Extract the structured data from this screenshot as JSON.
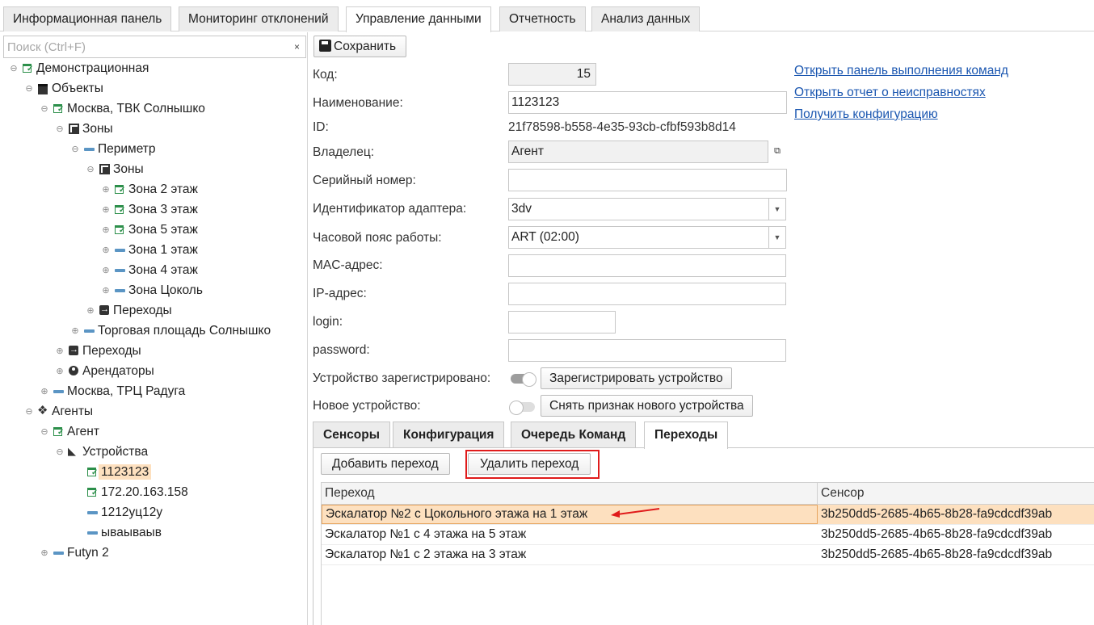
{
  "top_tabs": [
    "Информационная панель",
    "Мониторинг отклонений",
    "Управление данными",
    "Отчетность",
    "Анализ данных"
  ],
  "active_top_tab": "Управление данными",
  "search": {
    "placeholder": "Поиск (Ctrl+F)",
    "clear": "×"
  },
  "tree": [
    {
      "label": "Демонстрационная",
      "icon": "object-check-icon",
      "expander": "⊖"
    },
    {
      "label": "Объекты",
      "icon": "building-icon",
      "expander": "⊖"
    },
    {
      "label": "Москва, ТВК Солнышко",
      "icon": "object-check-icon",
      "expander": "⊖"
    },
    {
      "label": "Зоны",
      "icon": "zones-icon",
      "expander": "⊖"
    },
    {
      "label": "Периметр",
      "icon": "zone-dash-icon",
      "expander": "⊖"
    },
    {
      "label": "Зоны",
      "icon": "zones-icon",
      "expander": "⊖"
    },
    {
      "label": "Зона 2 этаж",
      "icon": "object-check-icon",
      "expander": "⊕"
    },
    {
      "label": "Зона 3 этаж",
      "icon": "object-check-icon",
      "expander": "⊕"
    },
    {
      "label": "Зона 5 этаж",
      "icon": "object-check-icon",
      "expander": "⊕"
    },
    {
      "label": "Зона 1 этаж",
      "icon": "zone-dash-icon",
      "expander": "⊕"
    },
    {
      "label": "Зона 4 этаж",
      "icon": "zone-dash-icon",
      "expander": "⊕"
    },
    {
      "label": "Зона Цоколь",
      "icon": "zone-dash-icon",
      "expander": "⊕"
    },
    {
      "label": "Переходы",
      "icon": "transition-icon",
      "expander": "⊕"
    },
    {
      "label": "Торговая площадь Солнышко",
      "icon": "zone-dash-icon",
      "expander": "⊕"
    },
    {
      "label": "Переходы",
      "icon": "transition-icon",
      "expander": "⊕"
    },
    {
      "label": "Арендаторы",
      "icon": "tenant-icon",
      "expander": "⊕"
    },
    {
      "label": "Москва, ТРЦ Радуга",
      "icon": "zone-dash-icon",
      "expander": "⊕"
    },
    {
      "label": "Агенты",
      "icon": "agents-icon",
      "expander": "⊖"
    },
    {
      "label": "Агент",
      "icon": "object-check-icon",
      "expander": "⊖"
    },
    {
      "label": "Устройства",
      "icon": "camera-icon",
      "expander": "⊖"
    },
    {
      "label": "1123123",
      "icon": "object-check-icon",
      "expander": ""
    },
    {
      "label": "172.20.163.158",
      "icon": "object-check-icon",
      "expander": ""
    },
    {
      "label": "1212уц12у",
      "icon": "zone-dash-icon",
      "expander": ""
    },
    {
      "label": "ываываыв",
      "icon": "zone-dash-icon",
      "expander": ""
    },
    {
      "label": "Futyn 2",
      "icon": "zone-dash-icon",
      "expander": "⊕"
    }
  ],
  "selected_tree_item": "1123123",
  "toolbar": {
    "save_label": "Сохранить"
  },
  "form": {
    "code_label": "Код:",
    "code_value": "15",
    "name_label": "Наименование:",
    "name_value": "1123123",
    "id_label": "ID:",
    "id_value": "21f78598-b558-4e35-93cb-cfbf593b8d14",
    "owner_label": "Владелец:",
    "owner_value": "Агент",
    "serial_label": "Серийный номер:",
    "serial_value": "",
    "adapter_label": "Идентификатор адаптера:",
    "adapter_value": "3dv",
    "timezone_label": "Часовой пояс работы:",
    "timezone_value": "ART (02:00)",
    "mac_label": "MAC-адрес:",
    "mac_value": "",
    "ip_label": "IP-адрес:",
    "ip_value": "",
    "login_label": "login:",
    "login_value": "",
    "password_label": "password:",
    "password_value": "",
    "registered_label": "Устройство зарегистрировано:",
    "registered": true,
    "register_button": "Зарегистрировать устройство",
    "new_device_label": "Новое устройство:",
    "new_device": false,
    "clear_new_button": "Снять признак нового устройства"
  },
  "links": [
    "Открыть панель выполнения команд",
    "Открыть отчет о неисправностях",
    "Получить конфигурацию"
  ],
  "sub_tabs": [
    "Сенсоры",
    "Конфигурация",
    "Очередь Команд",
    "Переходы"
  ],
  "active_sub_tab": "Переходы",
  "transitions": {
    "add_button": "Добавить переход",
    "delete_button": "Удалить переход",
    "columns": [
      "Переход",
      "Сенсор"
    ],
    "rows": [
      {
        "transition": "Эскалатор №2 с Цокольного этажа на 1 этаж",
        "sensor": "3b250dd5-2685-4b65-8b28-fa9cdcdf39ab",
        "selected": true
      },
      {
        "transition": "Эскалатор №1 с 4 этажа на 5 этаж",
        "sensor": "3b250dd5-2685-4b65-8b28-fa9cdcdf39ab",
        "selected": false
      },
      {
        "transition": "Эскалатор №1 с 2 этажа на 3 этаж",
        "sensor": "3b250dd5-2685-4b65-8b28-fa9cdcdf39ab",
        "selected": false
      }
    ]
  },
  "colors": {
    "accent_link": "#1a56b0",
    "selection": "#fde0bf",
    "annotation_red": "#e01b1b",
    "status_green": "#2c8f4a"
  }
}
